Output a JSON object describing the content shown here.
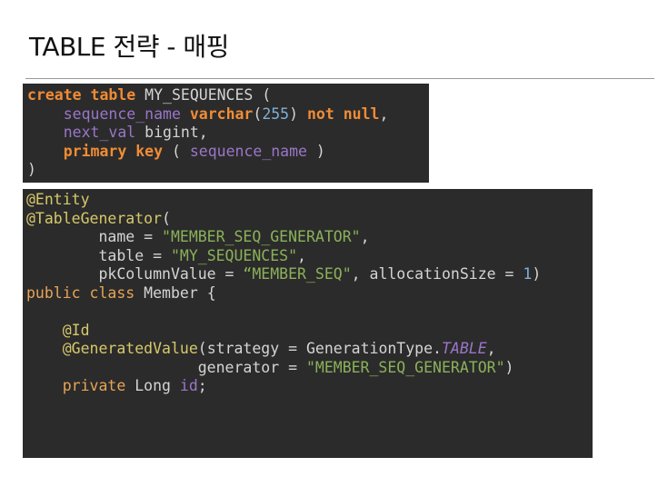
{
  "slide": {
    "title": "TABLE 전략 - 매핑"
  },
  "sql_code": {
    "lines": [
      [
        {
          "text": "create table",
          "style": "kw"
        },
        {
          "text": " MY_SEQUENCES (",
          "style": "plain"
        }
      ],
      [
        {
          "text": "    ",
          "style": "plain"
        },
        {
          "text": "sequence_name",
          "style": "field"
        },
        {
          "text": " ",
          "style": "plain"
        },
        {
          "text": "varchar",
          "style": "kw"
        },
        {
          "text": "(",
          "style": "plain"
        },
        {
          "text": "255",
          "style": "num"
        },
        {
          "text": ") ",
          "style": "plain"
        },
        {
          "text": "not null",
          "style": "kw"
        },
        {
          "text": ",",
          "style": "plain"
        }
      ],
      [
        {
          "text": "    ",
          "style": "plain"
        },
        {
          "text": "next_val",
          "style": "field"
        },
        {
          "text": " bigint,",
          "style": "plain"
        }
      ],
      [
        {
          "text": "    ",
          "style": "plain"
        },
        {
          "text": "primary key",
          "style": "kw"
        },
        {
          "text": " ( ",
          "style": "plain"
        },
        {
          "text": "sequence_name",
          "style": "field"
        },
        {
          "text": " )",
          "style": "plain"
        }
      ],
      [
        {
          "text": ")",
          "style": "plain"
        }
      ]
    ]
  },
  "java_code": {
    "lines": [
      [
        {
          "text": "@Entity",
          "style": "ann"
        }
      ],
      [
        {
          "text": "@TableGenerator",
          "style": "ann"
        },
        {
          "text": "(",
          "style": "plain"
        }
      ],
      [
        {
          "text": "        name = ",
          "style": "plain"
        },
        {
          "text": "\"MEMBER_SEQ_GENERATOR\"",
          "style": "str"
        },
        {
          "text": ",",
          "style": "plain"
        }
      ],
      [
        {
          "text": "        table = ",
          "style": "plain"
        },
        {
          "text": "\"MY_SEQUENCES\"",
          "style": "str"
        },
        {
          "text": ",",
          "style": "plain"
        }
      ],
      [
        {
          "text": "        pkColumnValue = ",
          "style": "plain"
        },
        {
          "text": "“MEMBER_SEQ\"",
          "style": "str"
        },
        {
          "text": ", allocationSize = ",
          "style": "plain"
        },
        {
          "text": "1",
          "style": "num"
        },
        {
          "text": ")",
          "style": "plain"
        }
      ],
      [
        {
          "text": "public class",
          "style": "mod"
        },
        {
          "text": " Member {",
          "style": "plain"
        }
      ],
      [
        {
          "text": "",
          "style": "plain"
        }
      ],
      [
        {
          "text": "    ",
          "style": "plain"
        },
        {
          "text": "@Id",
          "style": "ann"
        }
      ],
      [
        {
          "text": "    ",
          "style": "plain"
        },
        {
          "text": "@GeneratedValue",
          "style": "ann"
        },
        {
          "text": "(strategy = GenerationType.",
          "style": "plain"
        },
        {
          "text": "TABLE",
          "style": "konst"
        },
        {
          "text": ",",
          "style": "plain"
        }
      ],
      [
        {
          "text": "                   generator = ",
          "style": "plain"
        },
        {
          "text": "\"MEMBER_SEQ_GENERATOR\"",
          "style": "str"
        },
        {
          "text": ")",
          "style": "plain"
        }
      ],
      [
        {
          "text": "    ",
          "style": "plain"
        },
        {
          "text": "private",
          "style": "mod"
        },
        {
          "text": " Long ",
          "style": "plain"
        },
        {
          "text": "id",
          "style": "field"
        },
        {
          "text": ";",
          "style": "plain"
        }
      ]
    ]
  }
}
